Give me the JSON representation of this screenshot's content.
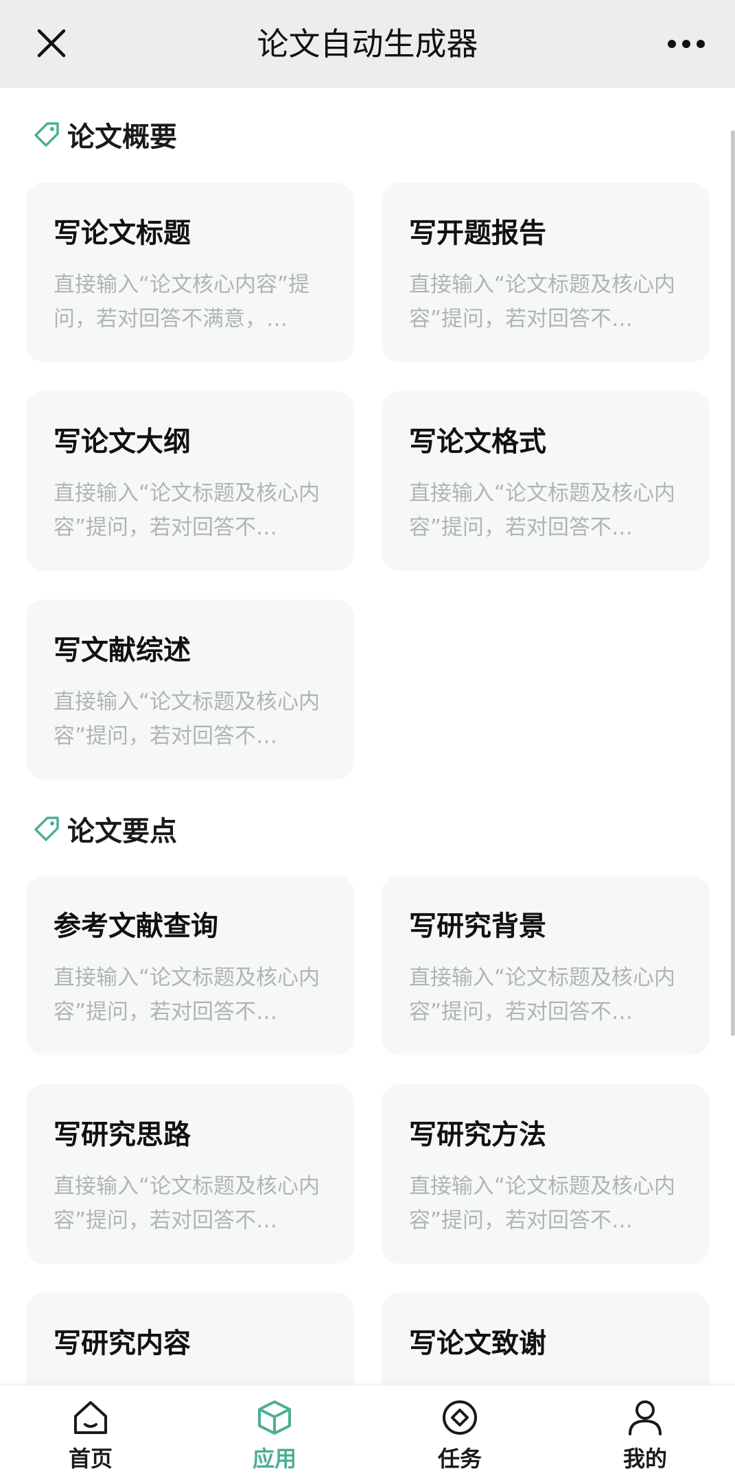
{
  "header": {
    "title": "论文自动生成器",
    "close_icon": "close-icon",
    "more_icon": "more-horizontal-icon"
  },
  "colors": {
    "accent": "#4bae95",
    "card_bg": "#f6f8f8",
    "desc_text": "#b0b4b6",
    "header_bg": "#ededed"
  },
  "sections": [
    {
      "title": "论文概要",
      "icon": "tag-icon",
      "cards": [
        {
          "title": "写论文标题",
          "desc": "直接输入“论文核心内容”提问，若对回答不满意，…"
        },
        {
          "title": "写开题报告",
          "desc": "直接输入“论文标题及核心内容”提问，若对回答不…"
        },
        {
          "title": "写论文大纲",
          "desc": "直接输入“论文标题及核心内容”提问，若对回答不…"
        },
        {
          "title": "写论文格式",
          "desc": "直接输入“论文标题及核心内容”提问，若对回答不…"
        },
        {
          "title": "写文献综述",
          "desc": "直接输入“论文标题及核心内容”提问，若对回答不…"
        }
      ]
    },
    {
      "title": "论文要点",
      "icon": "tag-icon",
      "cards": [
        {
          "title": "参考文献查询",
          "desc": "直接输入“论文标题及核心内容”提问，若对回答不…"
        },
        {
          "title": "写研究背景",
          "desc": "直接输入“论文标题及核心内容”提问，若对回答不…"
        },
        {
          "title": "写研究思路",
          "desc": "直接输入“论文标题及核心内容”提问，若对回答不…"
        },
        {
          "title": "写研究方法",
          "desc": "直接输入“论文标题及核心内容”提问，若对回答不…"
        },
        {
          "title": "写研究内容",
          "desc": ""
        },
        {
          "title": "写论文致谢",
          "desc": ""
        }
      ]
    }
  ],
  "bottom_nav": [
    {
      "label": "首页",
      "icon": "home-icon",
      "active": false
    },
    {
      "label": "应用",
      "icon": "cube-icon",
      "active": true
    },
    {
      "label": "任务",
      "icon": "target-icon",
      "active": false
    },
    {
      "label": "我的",
      "icon": "user-icon",
      "active": false
    }
  ]
}
